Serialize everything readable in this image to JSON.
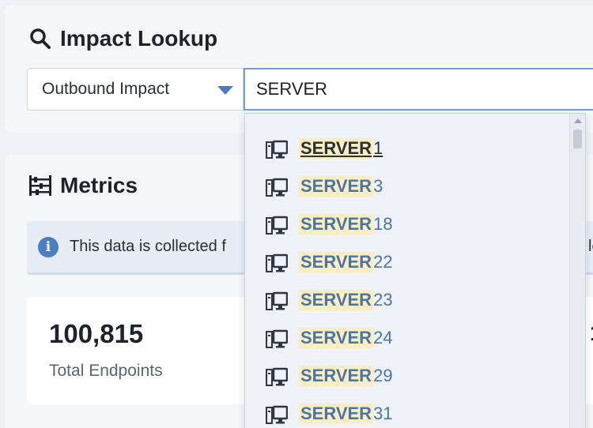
{
  "lookup": {
    "title": "Impact Lookup",
    "title_icon": "search-icon",
    "direction_select": {
      "selected": "Outbound Impact"
    },
    "search": {
      "value": "SERVER"
    }
  },
  "metrics": {
    "title": "Metrics",
    "title_icon": "abacus-icon",
    "info": {
      "icon": "info-icon",
      "text": "This data is collected f",
      "right_fragment": "le"
    },
    "card": {
      "value": "100,815",
      "label": "Total Endpoints",
      "right_fragment": "1"
    }
  },
  "dropdown": {
    "item_icon": "desktop-computer-icon",
    "items": [
      {
        "match": "SERVER",
        "rest": "1"
      },
      {
        "match": "SERVER",
        "rest": "3"
      },
      {
        "match": "SERVER",
        "rest": "18"
      },
      {
        "match": "SERVER",
        "rest": "22"
      },
      {
        "match": "SERVER",
        "rest": "23"
      },
      {
        "match": "SERVER",
        "rest": "24"
      },
      {
        "match": "SERVER",
        "rest": "29"
      },
      {
        "match": "SERVER",
        "rest": "31"
      }
    ]
  },
  "colors": {
    "accent": "#4a7ab8",
    "highlight": "#fbefc2",
    "link": "#4a74aa"
  }
}
